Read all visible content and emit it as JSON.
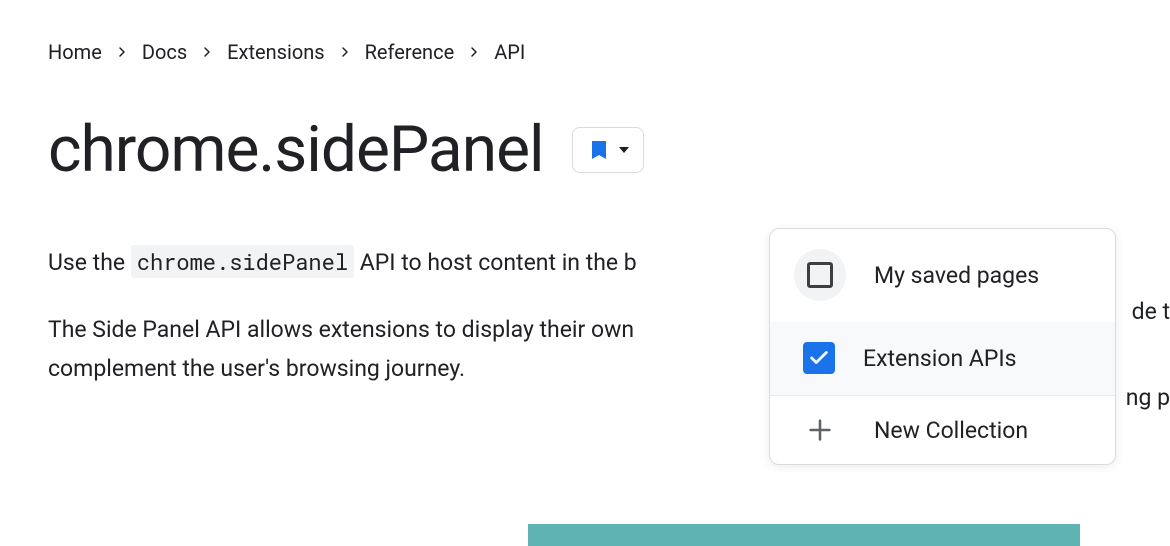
{
  "breadcrumb": {
    "items": [
      "Home",
      "Docs",
      "Extensions",
      "Reference",
      "API"
    ]
  },
  "page": {
    "title": "chrome.sidePanel",
    "intro_prefix": "Use the ",
    "intro_code": "chrome.sidePanel",
    "intro_suffix": " API to host content in the b",
    "description": "The Side Panel API allows extensions to display their own",
    "description_cont": "complement the user's browsing journey.",
    "cutoff_text1": "de t",
    "cutoff_text2": "ng p"
  },
  "dropdown": {
    "items": [
      {
        "label": "My saved pages",
        "checked": false
      },
      {
        "label": "Extension APIs",
        "checked": true
      }
    ],
    "new_collection": "New Collection"
  },
  "colors": {
    "accent": "#1a73e8",
    "teal": "#5fb3b3"
  }
}
